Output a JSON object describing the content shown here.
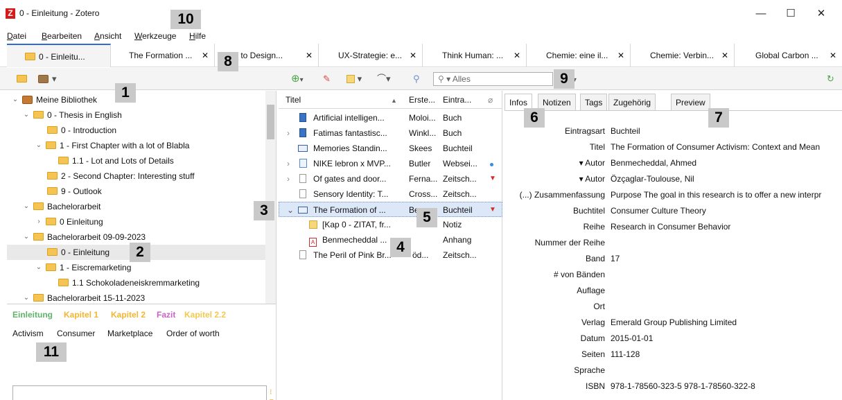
{
  "window": {
    "title": "0 - Einleitung - Zotero",
    "logo_letter": "Z",
    "controls": {
      "minimize": "—",
      "maximize": "☐",
      "close": "✕"
    }
  },
  "menu": [
    "Datei",
    "Bearbeiten",
    "Ansicht",
    "Werkzeuge",
    "Hilfe"
  ],
  "tabs": [
    {
      "label": "0 - Einleitu...",
      "active": true
    },
    {
      "label": "The Formation ...",
      "close": "✕"
    },
    {
      "label": "How to Design...",
      "close": "✕"
    },
    {
      "label": "UX-Strategie: e...",
      "close": "✕"
    },
    {
      "label": "Think Human: ...",
      "close": "✕"
    },
    {
      "label": "Chemie: eine il...",
      "close": "✕"
    },
    {
      "label": "Chemie: Verbin...",
      "close": "✕"
    },
    {
      "label": "Global Carbon ...",
      "close": "✕"
    }
  ],
  "search": {
    "placeholder": "▾ Alles"
  },
  "collections": [
    {
      "label": "Meine Bibliothek",
      "level": 0,
      "expanded": true,
      "type": "library"
    },
    {
      "label": "0 - Thesis in English",
      "level": 1,
      "expanded": true
    },
    {
      "label": "0 - Introduction",
      "level": 2
    },
    {
      "label": "1 - First Chapter with a lot of Blabla",
      "level": 2,
      "expanded": true
    },
    {
      "label": "1.1 - Lot and Lots of Details",
      "level": 3
    },
    {
      "label": "2 - Second Chapter: Interesting stuff",
      "level": 2
    },
    {
      "label": "9 - Outlook",
      "level": 2
    },
    {
      "label": "Bachelorarbeit",
      "level": 1,
      "expanded": true
    },
    {
      "label": "0 Einleitung",
      "level": 2,
      "collapsed": true
    },
    {
      "label": "Bachelorarbeit 09-09-2023",
      "level": 1,
      "expanded": true
    },
    {
      "label": "0 - Einleitung",
      "level": 2,
      "selected": true
    },
    {
      "label": "1 - Eiscremarketing",
      "level": 2,
      "expanded": true
    },
    {
      "label": "1.1 Schokoladeneiskremmarketing",
      "level": 3
    },
    {
      "label": "Bachelorarbeit 15-11-2023",
      "level": 1,
      "expanded": true
    }
  ],
  "colored_tags": [
    {
      "label": "Einleitung",
      "color": "#5fb36a"
    },
    {
      "label": "Kapitel 1",
      "color": "#f2b632"
    },
    {
      "label": "Kapitel 2",
      "color": "#f2b632"
    },
    {
      "label": "Fazit",
      "color": "#c764c4"
    },
    {
      "label": "Kapitel 2.2",
      "color": "#f2c94c"
    }
  ],
  "tags": [
    "Activism",
    "Consumer",
    "Marketplace",
    "Order of worth"
  ],
  "items_columns": {
    "title": "Titel",
    "creator": "Erste...",
    "type": "Eintra...",
    "sort_arrow": "▲"
  },
  "items": [
    {
      "icon": "book",
      "title": "Artificial intelligen...",
      "creator": "Moloi...",
      "type": "Buch"
    },
    {
      "icon": "book",
      "title": "Fatimas fantastisc...",
      "creator": "Winkl...",
      "type": "Buch",
      "chevron": "›"
    },
    {
      "icon": "open-book",
      "title": "Memories Standin...",
      "creator": "Skees",
      "type": "Buchteil"
    },
    {
      "icon": "web",
      "title": "NIKE lebron x MVP...",
      "creator": "Butler",
      "type": "Websei...",
      "chevron": "›",
      "attach": "dot"
    },
    {
      "icon": "doc",
      "title": "Of gates and door...",
      "creator": "Ferna...",
      "type": "Zeitsch...",
      "chevron": "›",
      "attach": "pdf"
    },
    {
      "icon": "doc",
      "title": "Sensory Identity: T...",
      "creator": "Cross...",
      "type": "Zeitsch..."
    },
    {
      "icon": "open-book",
      "title": "The Formation of ...",
      "creator": "Be",
      "type": "Buchteil",
      "chevron": "⌄",
      "attach": "pdf",
      "selected": true
    },
    {
      "icon": "note",
      "title": "[Kap 0 - ZITAT, fr...",
      "creator": "",
      "type": "Notiz",
      "child": true
    },
    {
      "icon": "pdf",
      "title": "Benmecheddal ...",
      "creator": "",
      "type": "Anhang",
      "child": true
    },
    {
      "icon": "doc",
      "title": "The Peril of Pink Br...",
      "creator": "öd...",
      "type": "Zeitsch..."
    }
  ],
  "info_tabs": [
    "Infos",
    "Notizen",
    "Tags",
    "Zugehörig",
    "Preview"
  ],
  "fields": [
    {
      "label": "Eintragsart",
      "value": "Buchteil"
    },
    {
      "label": "Titel",
      "value": "The Formation of Consumer Activism: Context and Mean"
    },
    {
      "label": "▾  Autor",
      "value": "Benmecheddal, Ahmed"
    },
    {
      "label": "▾  Autor",
      "value": "Özçaglar-Toulouse, Nil"
    },
    {
      "label": "(...) Zusammenfassung",
      "value": "Purpose The goal in this research is to offer a new interpr"
    },
    {
      "label": "Buchtitel",
      "value": "Consumer Culture Theory"
    },
    {
      "label": "Reihe",
      "value": "Research in Consumer Behavior"
    },
    {
      "label": "Nummer der Reihe",
      "value": ""
    },
    {
      "label": "Band",
      "value": "17"
    },
    {
      "label": "# von Bänden",
      "value": ""
    },
    {
      "label": "Auflage",
      "value": ""
    },
    {
      "label": "Ort",
      "value": ""
    },
    {
      "label": "Verlag",
      "value": "Emerald Group Publishing Limited"
    },
    {
      "label": "Datum",
      "value": "2015-01-01"
    },
    {
      "label": "Seiten",
      "value": "111-128"
    },
    {
      "label": "Sprache",
      "value": ""
    },
    {
      "label": "ISBN",
      "value": "978-1-78560-323-5 978-1-78560-322-8"
    }
  ],
  "callouts": [
    "1",
    "2",
    "3",
    "4",
    "5",
    "6",
    "7",
    "8",
    "9",
    "10",
    "11"
  ]
}
